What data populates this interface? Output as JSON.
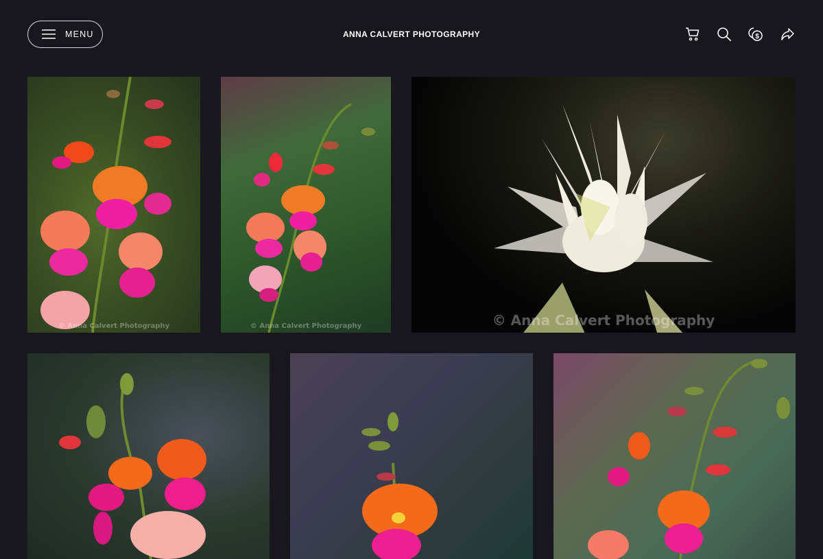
{
  "header": {
    "menu_label": "MENU",
    "site_title": "ANNA CALVERT PHOTOGRAPHY",
    "icons": [
      "cart-icon",
      "search-icon",
      "currency-icon",
      "share-icon"
    ]
  },
  "gallery": {
    "watermark": "© Anna Calvert Photography",
    "photos": [
      {
        "subject": "pink and orange pea flowers"
      },
      {
        "subject": "pink and orange pea flowers"
      },
      {
        "subject": "white protea flower"
      },
      {
        "subject": "pink and orange pea flowers"
      },
      {
        "subject": "orange pea flower"
      },
      {
        "subject": "pink and orange pea flowers"
      }
    ]
  },
  "colors": {
    "background": "#18171d",
    "text": "#ffffff"
  }
}
